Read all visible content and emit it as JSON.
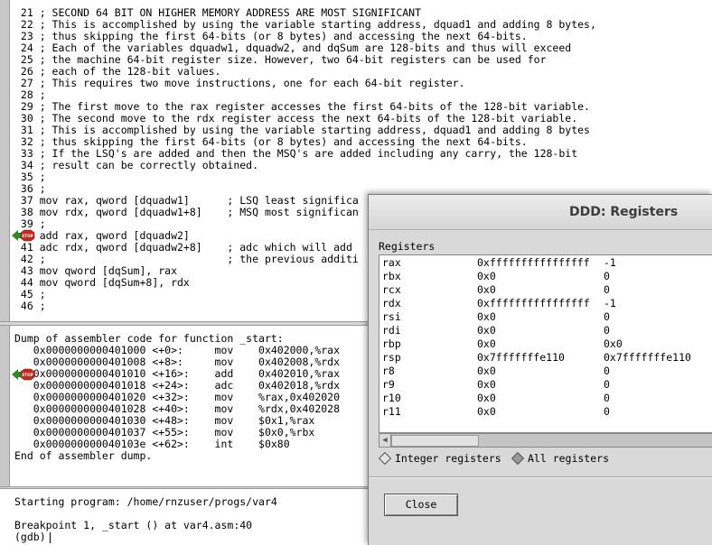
{
  "source": {
    "lines": [
      " 21 ; SECOND 64 BIT ON HIGHER MEMORY ADDRESS ARE MOST SIGNIFICANT",
      " 22 ; This is accomplished by using the variable starting address, dquad1 and adding 8 bytes,",
      " 23 ; thus skipping the first 64-bits (or 8 bytes) and accessing the next 64-bits.",
      " 24 ; Each of the variables dquadw1, dquadw2, and dqSum are 128-bits and thus will exceed",
      " 25 ; the machine 64-bit register size. However, two 64-bit registers can be used for",
      " 26 ; each of the 128-bit values.",
      " 27 ; This requires two move instructions, one for each 64-bit register.",
      " 28 ;",
      " 29 ; The first move to the rax register accesses the first 64-bits of the 128-bit variable.",
      " 30 ; The second move to the rdx register access the next 64-bits of the 128-bit variable.",
      " 31 ; This is accomplished by using the variable starting address, dquad1 and adding 8 bytes",
      " 32 ; thus skipping the first 64-bits (or 8 bytes) and accessing the next 64-bits.",
      " 33 ; If the LSQ's are added and then the MSQ's are added including any carry, the 128-bit",
      " 34 ; result can be correctly obtained.",
      " 35 ;",
      " 36 ;",
      " 37 mov rax, qword [dquadw1]      ; LSQ least significa",
      " 38 mov rdx, qword [dquadw1+8]    ; MSQ most significan",
      " 39 ;",
      "    add rax, qword [dquadw2]",
      " 41 adc rdx, qword [dquadw2+8]    ; adc which will add",
      " 42 ;                             ; the previous additi",
      " 43 mov qword [dqSum], rax",
      " 44 mov qword [dqSum+8], rdx",
      " 45 ;",
      " 46 ;"
    ]
  },
  "assembly": {
    "lines": [
      "Dump of assembler code for function _start:",
      "   0x0000000000401000 <+0>:     mov    0x402000,%rax",
      "   0x0000000000401008 <+8>:     mov    0x402008,%rdx",
      "   0x0000000000401010 <+16>:    add    0x402010,%rax",
      "   0x0000000000401018 <+24>:    adc    0x402018,%rdx",
      "   0x0000000000401020 <+32>:    mov    %rax,0x402020",
      "   0x0000000000401028 <+40>:    mov    %rdx,0x402028",
      "   0x0000000000401030 <+48>:    mov    $0x1,%rax",
      "   0x0000000000401037 <+55>:    mov    $0x0,%rbx",
      "   0x000000000040103e <+62>:    int    $0x80",
      "End of assembler dump."
    ]
  },
  "console": {
    "lines": [
      "Starting program: /home/rnzuser/progs/var4",
      "",
      "Breakpoint 1, _start () at var4.asm:40",
      "(gdb)"
    ]
  },
  "stop_label": "STOP",
  "dialog": {
    "title": "DDD: Registers",
    "section_label": "Registers",
    "registers": [
      {
        "name": "rax",
        "hex": "0xffffffffffffffff",
        "natural": "-1"
      },
      {
        "name": "rbx",
        "hex": "0x0",
        "natural": "0"
      },
      {
        "name": "rcx",
        "hex": "0x0",
        "natural": "0"
      },
      {
        "name": "rdx",
        "hex": "0xffffffffffffffff",
        "natural": "-1"
      },
      {
        "name": "rsi",
        "hex": "0x0",
        "natural": "0"
      },
      {
        "name": "rdi",
        "hex": "0x0",
        "natural": "0"
      },
      {
        "name": "rbp",
        "hex": "0x0",
        "natural": "0x0"
      },
      {
        "name": "rsp",
        "hex": "0x7fffffffe110",
        "natural": "0x7fffffffe110"
      },
      {
        "name": "r8",
        "hex": "0x0",
        "natural": "0"
      },
      {
        "name": "r9",
        "hex": "0x0",
        "natural": "0"
      },
      {
        "name": "r10",
        "hex": "0x0",
        "natural": "0"
      },
      {
        "name": "r11",
        "hex": "0x0",
        "natural": "0"
      }
    ],
    "radio_integer_label": "Integer registers",
    "radio_all_label": "All registers",
    "close_label": "Close"
  },
  "colors": {
    "stop_red": "#c8281e",
    "arrow_green": "#2e8b22"
  }
}
